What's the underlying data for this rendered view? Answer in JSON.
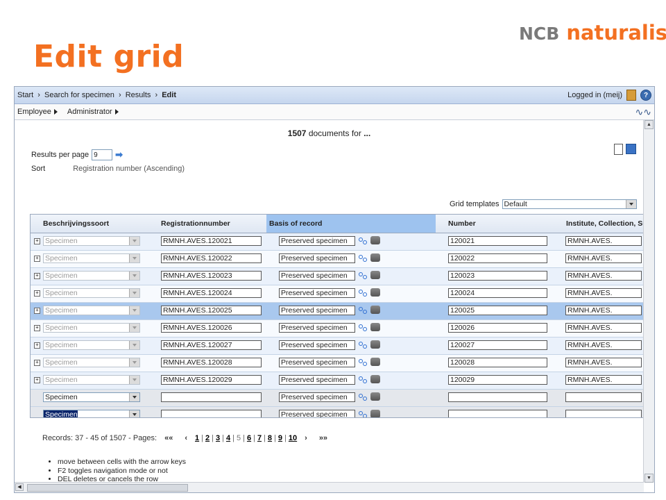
{
  "slide": {
    "title": "Edit grid",
    "logo_ncb": "NCB",
    "logo_naturalis": "naturalis"
  },
  "breadcrumb": {
    "items": [
      "Start",
      "›",
      "Search for specimen",
      "›",
      "Results",
      "›"
    ],
    "current": "Edit"
  },
  "login": {
    "text": "Logged in (meij)"
  },
  "menu": {
    "employee": "Employee",
    "administrator": "Administrator"
  },
  "summary": {
    "count": "1507",
    "text": "documents for",
    "query": "..."
  },
  "results_per_page": {
    "label": "Results per page",
    "value": "9"
  },
  "sort": {
    "label": "Sort",
    "value": "Registration number (Ascending)"
  },
  "grid_templates": {
    "label": "Grid templates",
    "value": "Default"
  },
  "columns": [
    "Beschrijvingssoort",
    "Registrationnumber",
    "Basis of record",
    "Number",
    "Institute, Collection, Subco"
  ],
  "rows": [
    {
      "type": "Specimen",
      "reg": "RMNH.AVES.120021",
      "basis": "Preserved specimen",
      "number": "120021",
      "inst": "RMNH.AVES."
    },
    {
      "type": "Specimen",
      "reg": "RMNH.AVES.120022",
      "basis": "Preserved specimen",
      "number": "120022",
      "inst": "RMNH.AVES."
    },
    {
      "type": "Specimen",
      "reg": "RMNH.AVES.120023",
      "basis": "Preserved specimen",
      "number": "120023",
      "inst": "RMNH.AVES."
    },
    {
      "type": "Specimen",
      "reg": "RMNH.AVES.120024",
      "basis": "Preserved specimen",
      "number": "120024",
      "inst": "RMNH.AVES."
    },
    {
      "type": "Specimen",
      "reg": "RMNH.AVES.120025",
      "basis": "Preserved specimen",
      "number": "120025",
      "inst": "RMNH.AVES."
    },
    {
      "type": "Specimen",
      "reg": "RMNH.AVES.120026",
      "basis": "Preserved specimen",
      "number": "120026",
      "inst": "RMNH.AVES."
    },
    {
      "type": "Specimen",
      "reg": "RMNH.AVES.120027",
      "basis": "Preserved specimen",
      "number": "120027",
      "inst": "RMNH.AVES."
    },
    {
      "type": "Specimen",
      "reg": "RMNH.AVES.120028",
      "basis": "Preserved specimen",
      "number": "120028",
      "inst": "RMNH.AVES."
    },
    {
      "type": "Specimen",
      "reg": "RMNH.AVES.120029",
      "basis": "Preserved specimen",
      "number": "120029",
      "inst": "RMNH.AVES."
    }
  ],
  "new_rows": [
    {
      "type": "Specimen",
      "basis": "Preserved specimen"
    },
    {
      "type": "Specimen",
      "basis": "Preserved specimen"
    }
  ],
  "pager": {
    "label": "Records: 37 - 45 of 1507 - Pages:",
    "first": "««",
    "prev": "‹",
    "next": "›",
    "last": "»»",
    "pages": [
      "1",
      "2",
      "3",
      "4",
      "5",
      "6",
      "7",
      "8",
      "9",
      "10"
    ],
    "current": "5"
  },
  "hints": [
    "move between cells with the arrow keys",
    "F2 toggles navigation mode or not",
    "DEL deletes or cancels the row"
  ],
  "colors": {
    "accent": "#f37021",
    "selected_row": "#a9c8ee",
    "header_selected": "#9ec3ef"
  }
}
